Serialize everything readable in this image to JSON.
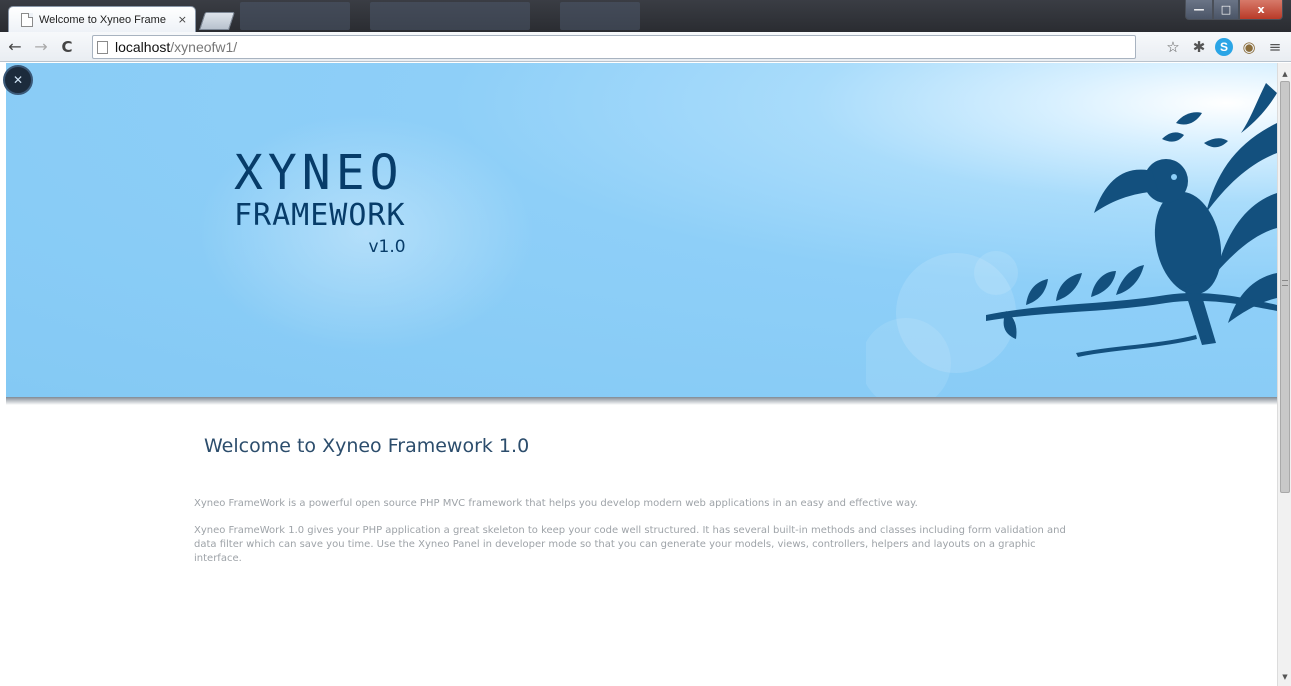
{
  "browser": {
    "tab": {
      "title": "Welcome to Xyneo Frame",
      "close": "×"
    },
    "window_controls": {
      "minimize": "—",
      "maximize": "□",
      "close": "x"
    },
    "nav": {
      "back": "←",
      "forward": "→",
      "reload": "C"
    },
    "address_bar": {
      "host": "localhost",
      "path": "/xyneofw1/"
    },
    "toolbar_icons": {
      "star": "☆",
      "extension": "✱",
      "skype": "S",
      "eye": "◉",
      "menu": "≡"
    }
  },
  "banner": {
    "badge": "✕",
    "logo": {
      "line1": "XYNEO",
      "line2": "FRAMEWORK",
      "version": "v1.0"
    },
    "accent_color": "#8ecff8",
    "logo_color": "#073c69"
  },
  "content": {
    "heading": "Welcome to Xyneo Framework 1.0",
    "paragraph1": "Xyneo FrameWork is a powerful open source PHP MVC framework that helps you develop modern web applications in an easy and effective way.",
    "paragraph2": "Xyneo FrameWork 1.0 gives your PHP application a great skeleton to keep your code well structured. It has several built-in methods and classes including form validation and data filter which can save you time. Use the Xyneo Panel in developer mode so that you can generate your models, views, controllers, helpers and layouts on a graphic interface."
  },
  "scrollbar": {
    "up": "▲",
    "down": "▼"
  }
}
